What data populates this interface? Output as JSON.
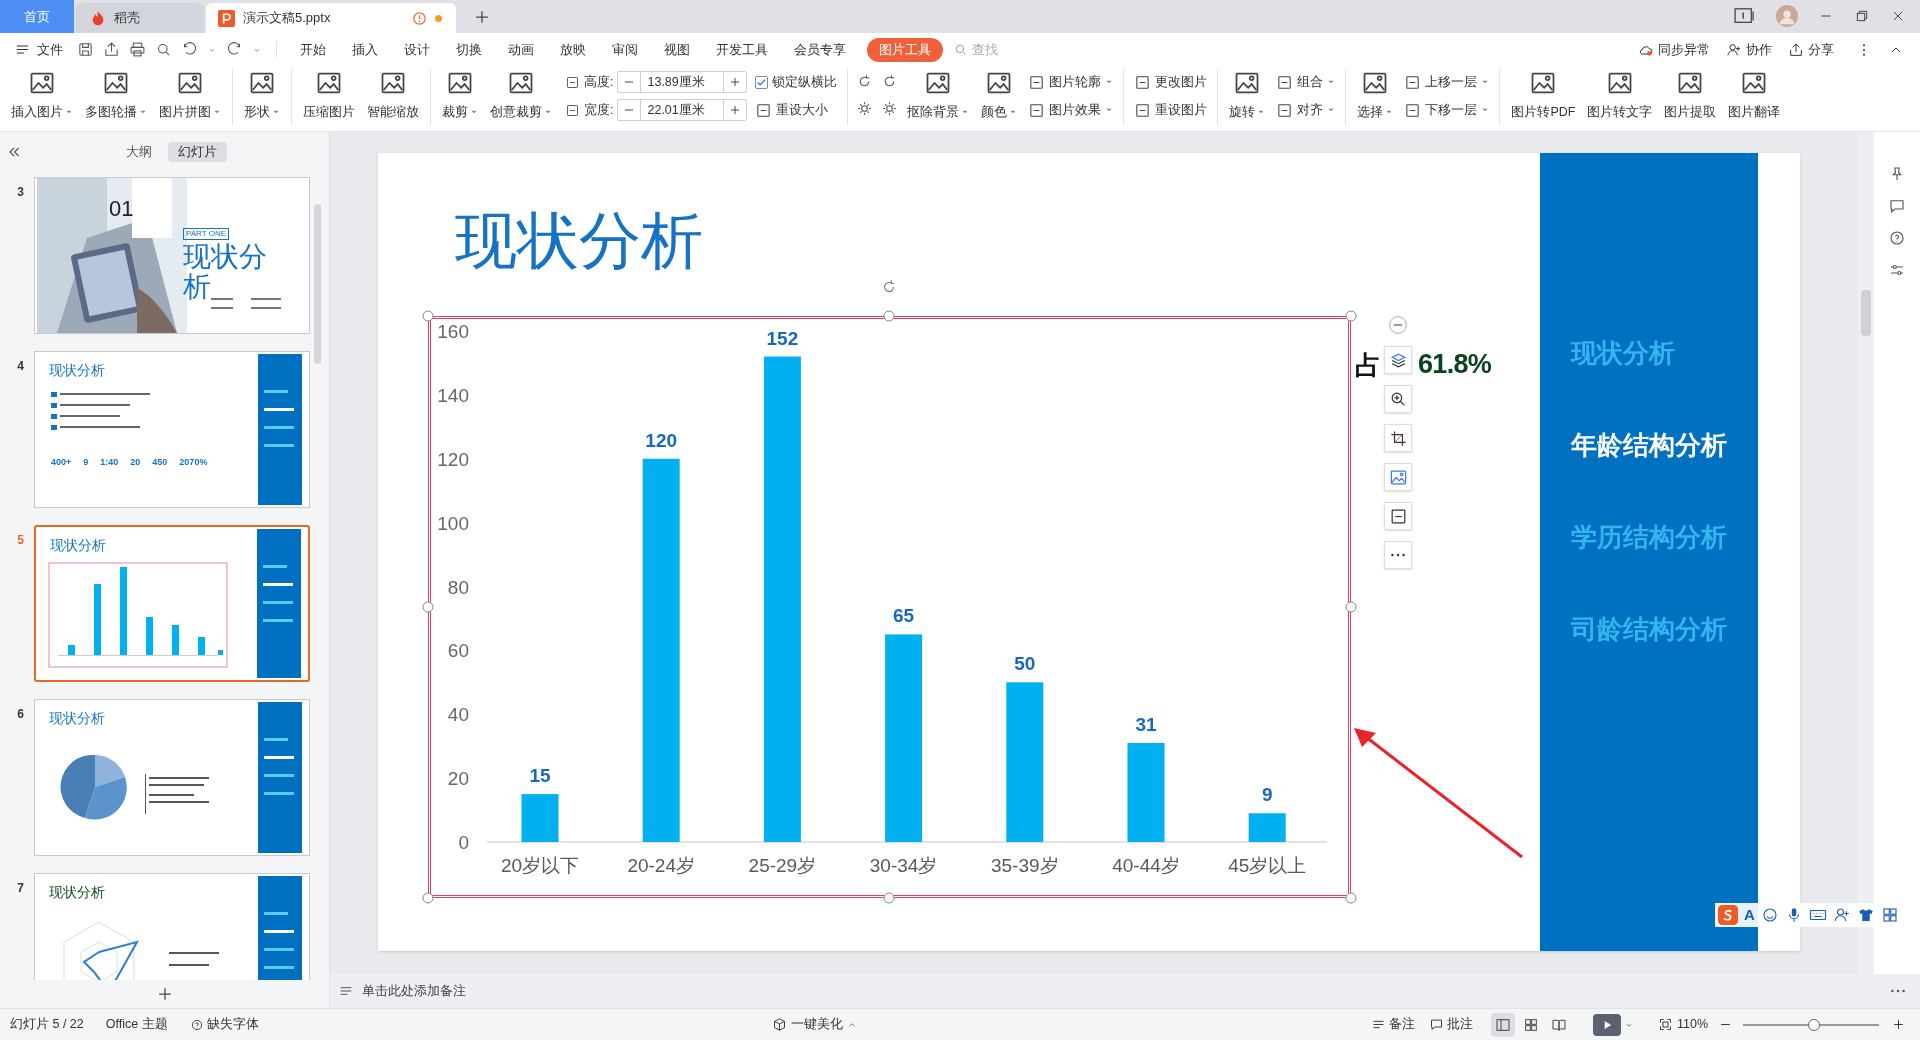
{
  "tabs": [
    {
      "label": "首页",
      "kind": "home",
      "selected": false
    },
    {
      "label": "稻壳",
      "kind": "app",
      "selected": false
    },
    {
      "label": "演示文稿5.pptx",
      "kind": "doc",
      "selected": true,
      "unsaved": true
    }
  ],
  "menu": {
    "file": "文件",
    "tabs": [
      {
        "label": "开始",
        "selected": false
      },
      {
        "label": "插入",
        "selected": false
      },
      {
        "label": "设计",
        "selected": false
      },
      {
        "label": "切换",
        "selected": false
      },
      {
        "label": "动画",
        "selected": false
      },
      {
        "label": "放映",
        "selected": false
      },
      {
        "label": "审阅",
        "selected": false
      },
      {
        "label": "视图",
        "selected": false
      },
      {
        "label": "开发工具",
        "selected": false
      },
      {
        "label": "会员专享",
        "selected": false
      },
      {
        "label": "图片工具",
        "selected": true
      }
    ],
    "search_placeholder": "查找",
    "actions": [
      "同步异常",
      "协作",
      "分享"
    ]
  },
  "ribbon": [
    {
      "kind": "large",
      "label": "插入图片",
      "dropdown": true
    },
    {
      "kind": "large",
      "label": "多图轮播",
      "dropdown": true
    },
    {
      "kind": "large",
      "label": "图片拼图",
      "dropdown": true
    },
    {
      "kind": "sep"
    },
    {
      "kind": "large",
      "label": "形状",
      "dropdown": true
    },
    {
      "kind": "sep"
    },
    {
      "kind": "large",
      "label": "压缩图片",
      "dropdown": false
    },
    {
      "kind": "large",
      "label": "智能缩放",
      "dropdown": false
    },
    {
      "kind": "sep"
    },
    {
      "kind": "large",
      "label": "裁剪",
      "dropdown": true
    },
    {
      "kind": "large",
      "label": "创意裁剪",
      "dropdown": true
    },
    {
      "kind": "size",
      "fields": [
        {
          "label": "高度:",
          "value": "13.89厘米"
        },
        {
          "label": "宽度:",
          "value": "22.01厘米"
        }
      ]
    },
    {
      "kind": "stack",
      "items": [
        {
          "label": "锁定纵横比",
          "checked": true
        },
        {
          "label": "重设大小"
        }
      ]
    },
    {
      "kind": "sep"
    },
    {
      "kind": "adjust"
    },
    {
      "kind": "large",
      "label": "抠除背景",
      "dropdown": true
    },
    {
      "kind": "large",
      "label": "颜色",
      "dropdown": true
    },
    {
      "kind": "stack",
      "items": [
        {
          "label": "图片轮廓",
          "dropdown": true
        },
        {
          "label": "图片效果",
          "dropdown": true
        }
      ]
    },
    {
      "kind": "sep"
    },
    {
      "kind": "stack",
      "items": [
        {
          "label": "更改图片"
        },
        {
          "label": "重设图片"
        }
      ]
    },
    {
      "kind": "sep"
    },
    {
      "kind": "large",
      "label": "旋转",
      "dropdown": true
    },
    {
      "kind": "stack",
      "items": [
        {
          "label": "组合",
          "dropdown": true
        },
        {
          "label": "对齐",
          "dropdown": true
        }
      ]
    },
    {
      "kind": "sep"
    },
    {
      "kind": "large",
      "label": "选择",
      "dropdown": true
    },
    {
      "kind": "stack",
      "items": [
        {
          "label": "上移一层",
          "dropdown": true
        },
        {
          "label": "下移一层",
          "dropdown": true
        }
      ]
    },
    {
      "kind": "sep"
    },
    {
      "kind": "large",
      "label": "图片转PDF",
      "dropdown": false
    },
    {
      "kind": "large",
      "label": "图片转文字",
      "dropdown": false
    },
    {
      "kind": "large",
      "label": "图片提取",
      "dropdown": false
    },
    {
      "kind": "large",
      "label": "图片翻译",
      "dropdown": false
    }
  ],
  "panel": {
    "views": [
      {
        "label": "大纲",
        "selected": false
      },
      {
        "label": "幻灯片",
        "selected": true
      }
    ],
    "slides": [
      {
        "number": "3",
        "kind": "cover",
        "selected": false,
        "title": "现状分析",
        "big": "01",
        "tag": "PART ONE"
      },
      {
        "number": "4",
        "kind": "stats",
        "selected": false,
        "title": "现状分析",
        "stats": [
          "400+",
          "9",
          "1:40",
          "20",
          "450",
          "2070%"
        ]
      },
      {
        "number": "5",
        "kind": "chart",
        "selected": true,
        "title": "现状分析"
      },
      {
        "number": "6",
        "kind": "pie",
        "selected": false,
        "title": "现状分析"
      },
      {
        "number": "7",
        "kind": "radar",
        "selected": false,
        "title": "现状分析"
      }
    ]
  },
  "slide": {
    "title": "现状分析",
    "chart_data": {
      "type": "bar",
      "categories": [
        "20岁以下",
        "20-24岁",
        "25-29岁",
        "30-34岁",
        "35-39岁",
        "40-44岁",
        "45岁以上"
      ],
      "values": [
        15,
        120,
        152,
        65,
        50,
        31,
        9
      ],
      "ylim": [
        0,
        160
      ],
      "yticks": [
        0,
        20,
        40,
        60,
        80,
        100,
        120,
        140,
        160
      ],
      "data_labels": true
    },
    "side_note": [
      "占",
      "61.8%"
    ],
    "nav": [
      {
        "label": "现状分析",
        "selected": false
      },
      {
        "label": "年龄结构分析",
        "selected": true
      },
      {
        "label": "学历结构分析",
        "selected": false
      },
      {
        "label": "司龄结构分析",
        "selected": false
      }
    ]
  },
  "notes_placeholder": "单击此处添加备注",
  "ime": {
    "label": "A"
  },
  "status": {
    "slide_count": "幻灯片 5 / 22",
    "theme": "Office 主题",
    "missing_fonts": "缺失字体",
    "beautify": "一键美化",
    "notes": "备注",
    "comments": "批注",
    "view_modes": [
      {
        "kind": "normal",
        "selected": true
      },
      {
        "kind": "sorter",
        "selected": false
      },
      {
        "kind": "reading",
        "selected": false
      }
    ],
    "zoom": "110%",
    "zoom_slider": {
      "level": 0.52
    }
  }
}
